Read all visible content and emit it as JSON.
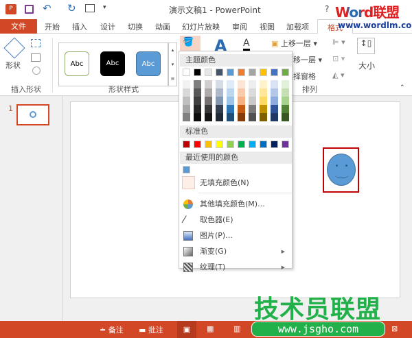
{
  "title": "演示文稿1 - PowerPoint",
  "help": "?",
  "watermark_top": {
    "brand": "Word联盟",
    "url": "www.wordlm.com"
  },
  "watermark_bottom": {
    "brand": "技术员联盟",
    "url": "www.jsgho.com"
  },
  "tabs": [
    "文件",
    "开始",
    "插入",
    "设计",
    "切换",
    "动画",
    "幻灯片放映",
    "审阅",
    "视图",
    "加载项",
    "格式"
  ],
  "ribbon": {
    "insert_shapes": {
      "label": "插入形状",
      "shapes_button": "形状"
    },
    "shape_styles": {
      "label": "形状样式",
      "styles": [
        "Abc",
        "Abc",
        "Abc"
      ]
    },
    "arrange": {
      "label": "排列",
      "bring_forward": "上移一层",
      "send_backward": "下移一层",
      "selection_pane": "选择窗格"
    },
    "size": {
      "label": "大小"
    }
  },
  "slides": {
    "number": "1"
  },
  "fill_menu": {
    "theme_header": "主题颜色",
    "theme_colors": [
      "#FFFFFF",
      "#000000",
      "#E7E6E6",
      "#44546A",
      "#5B9BD5",
      "#ED7D31",
      "#A5A5A5",
      "#FFC000",
      "#4472C4",
      "#70AD47"
    ],
    "theme_shades": [
      [
        "#F2F2F2",
        "#D9D9D9",
        "#BFBFBF",
        "#A6A6A6",
        "#808080"
      ],
      [
        "#7F7F7F",
        "#595959",
        "#404040",
        "#262626",
        "#0D0D0D"
      ],
      [
        "#D0CECE",
        "#AEAAAA",
        "#757171",
        "#3A3838",
        "#171616"
      ],
      [
        "#D6DCE4",
        "#ADB9CA",
        "#8497B0",
        "#333F4F",
        "#222A35"
      ],
      [
        "#DEEBF6",
        "#BDD7EE",
        "#9DC3E6",
        "#2E75B5",
        "#1F4E79"
      ],
      [
        "#FBE5D5",
        "#F7CBAC",
        "#F4B183",
        "#C55A11",
        "#843C0B"
      ],
      [
        "#EDEDED",
        "#DBDBDB",
        "#C9C9C9",
        "#7B7B7B",
        "#525252"
      ],
      [
        "#FFF2CC",
        "#FFE699",
        "#FFD966",
        "#BF9000",
        "#7F6000"
      ],
      [
        "#DAE3F3",
        "#B4C7E7",
        "#8FAADC",
        "#2F5597",
        "#203864"
      ],
      [
        "#E2F0D9",
        "#C5E0B4",
        "#A9D18E",
        "#538135",
        "#385723"
      ]
    ],
    "standard_header": "标准色",
    "standard_colors": [
      "#C00000",
      "#FF0000",
      "#FFC000",
      "#FFFF00",
      "#92D050",
      "#00B050",
      "#00B0F0",
      "#0070C0",
      "#002060",
      "#7030A0"
    ],
    "recent_header": "最近使用的颜色",
    "recent_colors": [
      "#5B9BD5"
    ],
    "no_fill": "无填充颜色(N)",
    "items": [
      {
        "label": "其他填充颜色(M)...",
        "icon": "color-wheel-icon"
      },
      {
        "label": "取色器(E)",
        "icon": "eyedropper-icon"
      },
      {
        "label": "图片(P)...",
        "icon": "picture-icon"
      },
      {
        "label": "渐变(G)",
        "icon": "gradient-icon",
        "submenu": true
      },
      {
        "label": "纹理(T)",
        "icon": "texture-icon",
        "submenu": true
      }
    ]
  },
  "shape": {
    "fill": "#5B9BD5",
    "selection_color": "#C00000"
  },
  "status": {
    "notes": "备注",
    "comments": "批注",
    "bar_color": "#D24726"
  }
}
